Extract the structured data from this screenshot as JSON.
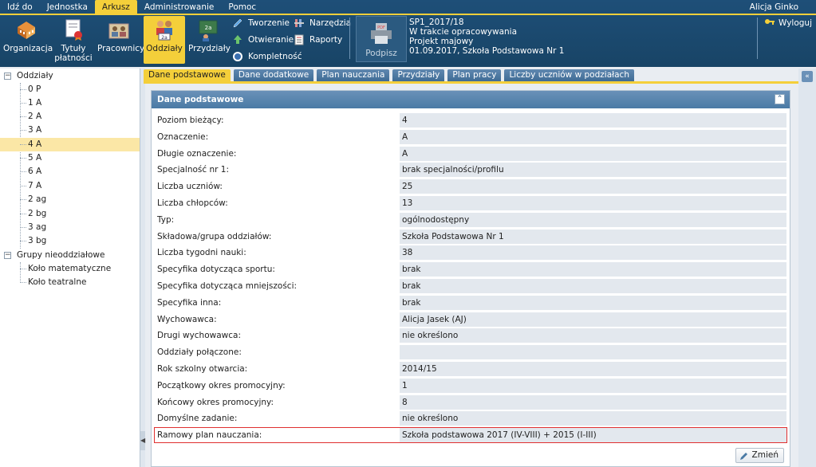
{
  "menu": {
    "items": [
      "Idź do",
      "Jednostka",
      "Arkusz",
      "Administrowanie",
      "Pomoc"
    ],
    "active_index": 2,
    "user": "Alicja Ginko"
  },
  "toolbar": {
    "organizacja": "Organizacja",
    "tytuly_1": "Tytuły",
    "tytuly_2": "płatności",
    "pracownicy": "Pracownicy",
    "oddzialy": "Oddziały",
    "przydzialy": "Przydziały",
    "tworzenie": "Tworzenie",
    "otwieranie": "Otwieranie",
    "kompletnosc": "Kompletność",
    "narzedzia": "Narzędzia",
    "raporty": "Raporty",
    "podpisz": "Podpisz",
    "wyloguj": "Wyloguj"
  },
  "doc_info": {
    "line1": "SP1_2017/18",
    "line2": "W trakcie opracowywania",
    "line3": "Projekt majowy",
    "line4": "01.09.2017, Szkoła Podstawowa Nr 1"
  },
  "tree": {
    "root1": "Oddziały",
    "classes": [
      "0 P",
      "1 A",
      "2 A",
      "3 A",
      "4 A",
      "5 A",
      "6 A",
      "7 A",
      "2 ag",
      "2 bg",
      "3 ag",
      "3 bg"
    ],
    "selected": "4 A",
    "root2": "Grupy nieoddziałowe",
    "groups": [
      "Koło matematyczne",
      "Koło teatralne"
    ],
    "expander_symbol": "−"
  },
  "tabs": [
    "Dane podstawowe",
    "Dane dodatkowe",
    "Plan nauczania",
    "Przydziały",
    "Plan pracy",
    "Liczby uczniów w podziałach"
  ],
  "panel": {
    "title": "Dane podstawowe",
    "button": "Zmień",
    "rows": [
      {
        "label": "Poziom bieżący:",
        "value": "4"
      },
      {
        "label": "Oznaczenie:",
        "value": "A"
      },
      {
        "label": "Długie oznaczenie:",
        "value": "A"
      },
      {
        "label": "Specjalność nr 1:",
        "value": "brak specjalności/profilu"
      },
      {
        "label": "Liczba uczniów:",
        "value": "25"
      },
      {
        "label": "Liczba chłopców:",
        "value": "13"
      },
      {
        "label": "Typ:",
        "value": "ogólnodostępny"
      },
      {
        "label": "Składowa/grupa oddziałów:",
        "value": "Szkoła Podstawowa Nr 1"
      },
      {
        "label": "Liczba tygodni nauki:",
        "value": "38"
      },
      {
        "label": "Specyfika dotycząca sportu:",
        "value": "brak"
      },
      {
        "label": "Specyfika dotycząca mniejszości:",
        "value": "brak"
      },
      {
        "label": "Specyfika inna:",
        "value": "brak"
      },
      {
        "label": "Wychowawca:",
        "value": "Alicja Jasek (AJ)"
      },
      {
        "label": "Drugi wychowawca:",
        "value": "nie określono"
      },
      {
        "label": "Oddziały połączone:",
        "value": ""
      },
      {
        "label": "Rok szkolny otwarcia:",
        "value": "2014/15"
      },
      {
        "label": "Początkowy okres promocyjny:",
        "value": "1"
      },
      {
        "label": "Końcowy okres promocyjny:",
        "value": "8"
      },
      {
        "label": "Domyślne zadanie:",
        "value": "nie określono"
      },
      {
        "label": "Ramowy plan nauczania:",
        "value": "Szkoła podstawowa 2017 (IV-VIII) + 2015 (I-III)",
        "highlighted": true
      }
    ]
  }
}
